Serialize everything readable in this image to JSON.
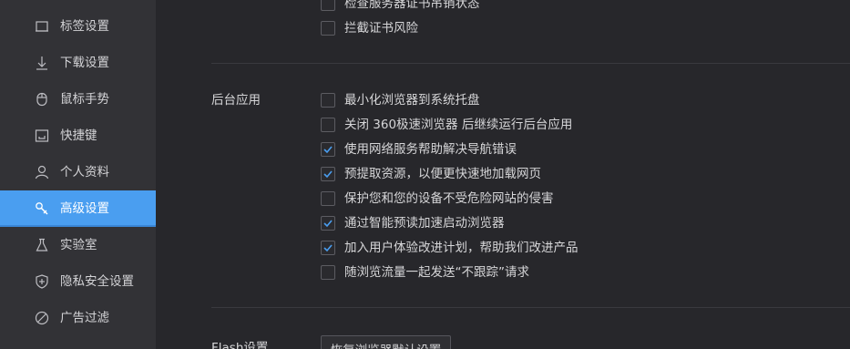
{
  "sidebar": {
    "items": [
      {
        "label": "标签设置",
        "icon": "tab-icon",
        "active": false
      },
      {
        "label": "下载设置",
        "icon": "download-icon",
        "active": false
      },
      {
        "label": "鼠标手势",
        "icon": "mouse-icon",
        "active": false
      },
      {
        "label": "快捷键",
        "icon": "shortcut-icon",
        "active": false
      },
      {
        "label": "个人资料",
        "icon": "user-icon",
        "active": false
      },
      {
        "label": "高级设置",
        "icon": "advanced-icon",
        "active": true
      },
      {
        "label": "实验室",
        "icon": "flask-icon",
        "active": false
      },
      {
        "label": "隐私安全设置",
        "icon": "shield-icon",
        "active": false
      },
      {
        "label": "广告过滤",
        "icon": "block-icon",
        "active": false
      }
    ]
  },
  "certificate": {
    "options": [
      {
        "label": "检查服务器证书吊销状态",
        "checked": false
      },
      {
        "label": "拦截证书风险",
        "checked": false
      }
    ]
  },
  "background_apps": {
    "title": "后台应用",
    "options": [
      {
        "label": "最小化浏览器到系统托盘",
        "checked": false
      },
      {
        "label": "关闭 360极速浏览器 后继续运行后台应用",
        "checked": false
      },
      {
        "label": "使用网络服务帮助解决导航错误",
        "checked": true
      },
      {
        "label": "预提取资源，以便更快速地加载网页",
        "checked": true
      },
      {
        "label": "保护您和您的设备不受危险网站的侵害",
        "checked": false
      },
      {
        "label": "通过智能预读加速启动浏览器",
        "checked": true
      },
      {
        "label": "加入用户体验改进计划，帮助我们改进产品",
        "checked": true
      },
      {
        "label": "随浏览流量一起发送“不跟踪”请求",
        "checked": false
      }
    ]
  },
  "flash": {
    "title": "Flash设置",
    "reset_button": "恢复浏览器默认设置"
  },
  "colors": {
    "accent": "#4a9ef0",
    "sidebar_bg": "#323236",
    "content_bg": "#27272b"
  }
}
